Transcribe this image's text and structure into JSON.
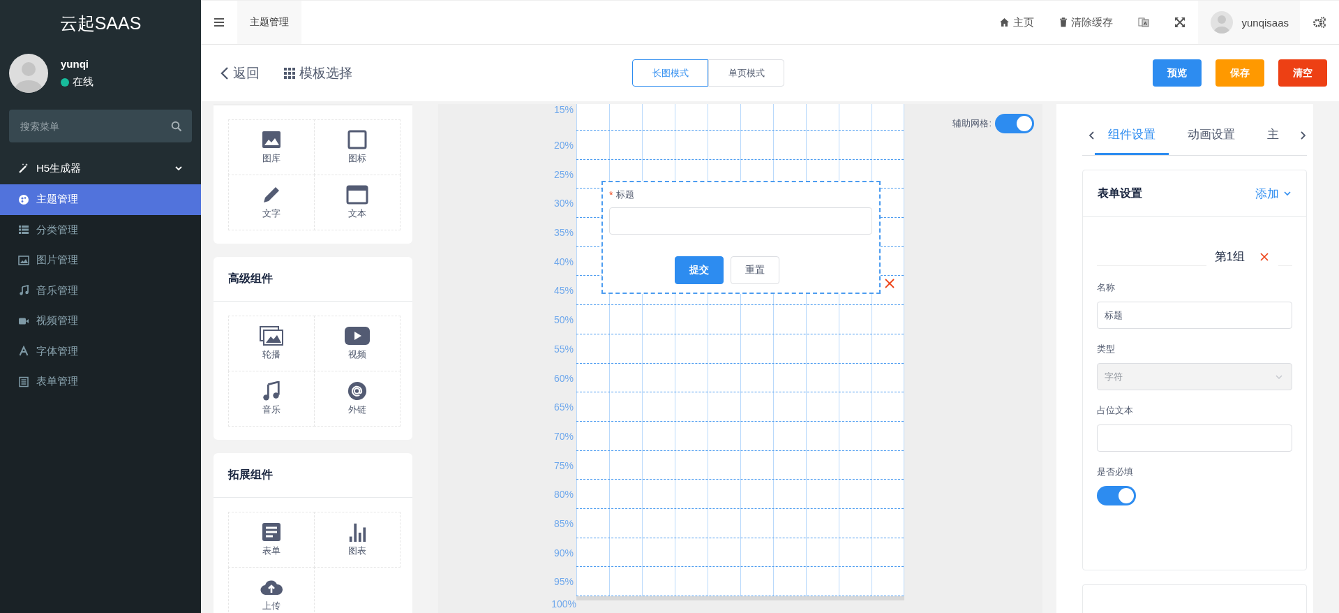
{
  "sidebar": {
    "logo": "云起SAAS",
    "user": {
      "name": "yunqi",
      "status": "在线"
    },
    "search": {
      "placeholder": "搜索菜单"
    },
    "menu": [
      {
        "label": "H5生成器",
        "expanded": true,
        "children": [
          {
            "label": "主题管理",
            "selected": true
          },
          {
            "label": "分类管理",
            "selected": false
          },
          {
            "label": "图片管理",
            "selected": false
          },
          {
            "label": "音乐管理",
            "selected": false
          },
          {
            "label": "视频管理",
            "selected": false
          },
          {
            "label": "字体管理",
            "selected": false
          },
          {
            "label": "表单管理",
            "selected": false
          }
        ]
      }
    ]
  },
  "topbar": {
    "tabs": [
      {
        "label": "主题管理",
        "selected": true
      }
    ],
    "links": [
      "主页",
      "清除缓存"
    ],
    "user": "yunqisaas"
  },
  "toolbar": {
    "back": "返回",
    "templates": "模板选择",
    "modes": [
      {
        "label": "长图模式",
        "selected": true
      },
      {
        "label": "单页模式",
        "selected": false
      }
    ],
    "actions": [
      {
        "label": "预览",
        "color": "#2d8cf0"
      },
      {
        "label": "保存",
        "color": "#ff9900"
      },
      {
        "label": "清空",
        "color": "#ed4014"
      }
    ]
  },
  "components": {
    "groups": [
      {
        "items": [
          "图库",
          "图标",
          "文字",
          "文本"
        ]
      },
      {
        "title": "高级组件",
        "items": [
          "轮播",
          "视频",
          "音乐",
          "外链"
        ]
      },
      {
        "title": "拓展组件",
        "items": [
          "表单",
          "图表",
          "上传"
        ]
      }
    ]
  },
  "canvas": {
    "grid_toggle": {
      "label": "辅助网格:",
      "on": true
    },
    "ruler": [
      "15%",
      "20%",
      "25%",
      "30%",
      "35%",
      "40%",
      "45%",
      "50%",
      "55%",
      "60%",
      "65%",
      "70%",
      "75%",
      "80%",
      "85%",
      "90%",
      "95%",
      "100%"
    ],
    "form": {
      "field_label": "标题",
      "required": true,
      "required_mark": "*",
      "buttons": [
        "提交",
        "重置"
      ]
    }
  },
  "settings": {
    "tabs": [
      {
        "label": "组件设置",
        "selected": true
      },
      {
        "label": "动画设置",
        "selected": false
      },
      {
        "label": "主",
        "selected": false
      }
    ],
    "card": {
      "title": "表单设置",
      "add": "添加",
      "group": "第1组",
      "fields": [
        {
          "kind": "text",
          "label": "名称",
          "value": "标题"
        },
        {
          "kind": "select",
          "label": "类型",
          "value": "字符",
          "disabled": true
        },
        {
          "kind": "text",
          "label": "占位文本"
        },
        {
          "kind": "switch",
          "label": "是否必填",
          "on": true
        }
      ]
    }
  }
}
